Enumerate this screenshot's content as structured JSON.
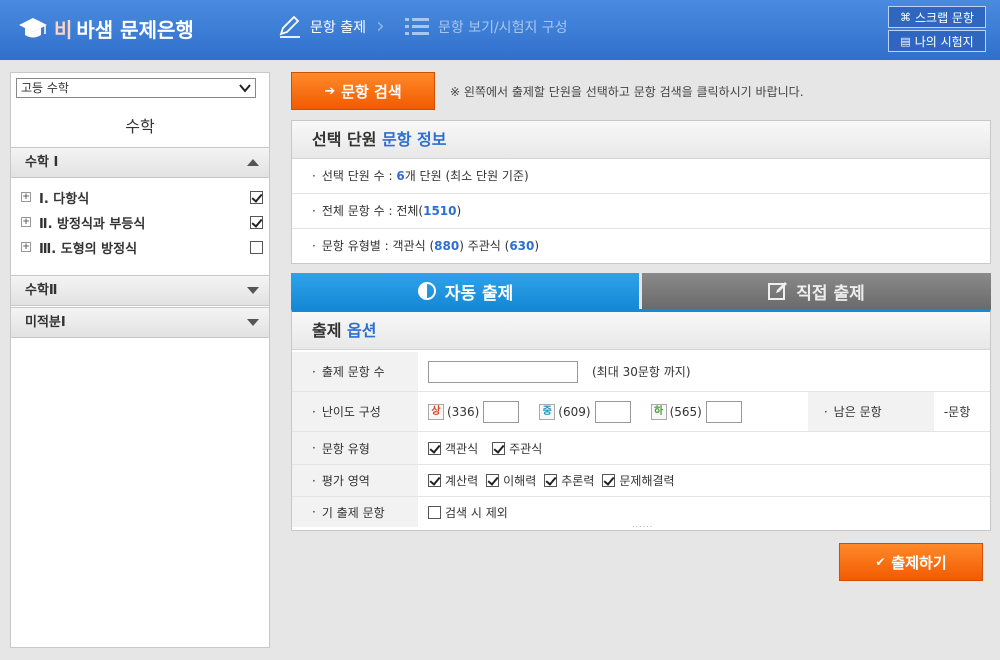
{
  "header": {
    "logo_bi": "비",
    "logo_title": "바샘 문제은행",
    "step1": "문항 출제",
    "step2": "문항 보기/시험지 구성",
    "scrap_button": "스크랩 문항",
    "my_exam_button": "나의 시험지"
  },
  "sidebar": {
    "subject_selected": "고등 수학",
    "subject_title": "수학",
    "sections": [
      {
        "label": "수학 Ⅰ",
        "expanded": true
      },
      {
        "label": "수학Ⅱ",
        "expanded": false
      },
      {
        "label": "미적분Ⅰ",
        "expanded": false
      }
    ],
    "units": [
      {
        "label": "Ⅰ. 다항식",
        "checked": true
      },
      {
        "label": "Ⅱ. 방정식과 부등식",
        "checked": true
      },
      {
        "label": "Ⅲ. 도형의 방정식",
        "checked": false
      }
    ]
  },
  "search": {
    "button_label": "문항 검색",
    "hint": "※ 왼쪽에서 출제할 단원을 선택하고 문항 검색을 클릭하시기 바랍니다."
  },
  "info": {
    "title_part1": "선택 단원",
    "title_part2": "문항 정보",
    "unit_count_label": "선택 단원 수 : ",
    "unit_count": "6",
    "unit_count_suffix": "개 단원 (최소 단원 기준)",
    "total_label": "전체 문항 수 : 전체(",
    "total": "1510",
    "total_suffix": ")",
    "type_label": "문항 유형별 : 객관식 (",
    "objective": "880",
    "type_mid": ") 주관식 (",
    "subjective": "630",
    "type_suffix": ")"
  },
  "tabs": {
    "auto": "자동 출제",
    "manual": "직접 출제"
  },
  "options": {
    "title_part1": "출제",
    "title_part2": "옵션",
    "question_count_label": "출제 문항 수",
    "question_count_hint": "(최대 30문항 까지)",
    "difficulty_label": "난이도 구성",
    "difficulty": [
      {
        "badge": "상",
        "count": "(336)"
      },
      {
        "badge": "중",
        "count": "(609)"
      },
      {
        "badge": "하",
        "count": "(565)"
      }
    ],
    "remaining_label": "남은 문항",
    "remaining_value": "-문항",
    "type_label": "문항 유형",
    "types": [
      {
        "label": "객관식",
        "checked": true
      },
      {
        "label": "주관식",
        "checked": true
      }
    ],
    "area_label": "평가 영역",
    "areas": [
      {
        "label": "계산력",
        "checked": true
      },
      {
        "label": "이해력",
        "checked": true
      },
      {
        "label": "추론력",
        "checked": true
      },
      {
        "label": "문제해결력",
        "checked": true
      }
    ],
    "prior_label": "기 출제 문항",
    "prior_exclude": "검색 시 제외",
    "resize_handle": "......"
  },
  "submit": {
    "label": "출제하기"
  },
  "colors": {
    "header": "#3070cc",
    "accent_orange": "#f25a00",
    "accent_blue": "#2d6fd0",
    "tab_active": "#1588d6"
  }
}
